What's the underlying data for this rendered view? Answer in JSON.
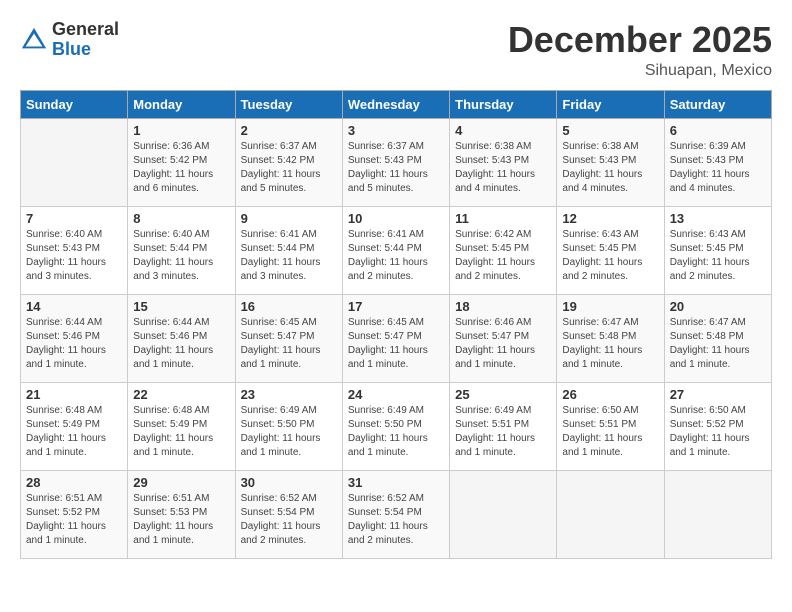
{
  "header": {
    "logo_general": "General",
    "logo_blue": "Blue",
    "month": "December 2025",
    "location": "Sihuapan, Mexico"
  },
  "days_of_week": [
    "Sunday",
    "Monday",
    "Tuesday",
    "Wednesday",
    "Thursday",
    "Friday",
    "Saturday"
  ],
  "weeks": [
    [
      {
        "num": "",
        "sunrise": "",
        "sunset": "",
        "daylight": ""
      },
      {
        "num": "1",
        "sunrise": "Sunrise: 6:36 AM",
        "sunset": "Sunset: 5:42 PM",
        "daylight": "Daylight: 11 hours and 6 minutes."
      },
      {
        "num": "2",
        "sunrise": "Sunrise: 6:37 AM",
        "sunset": "Sunset: 5:42 PM",
        "daylight": "Daylight: 11 hours and 5 minutes."
      },
      {
        "num": "3",
        "sunrise": "Sunrise: 6:37 AM",
        "sunset": "Sunset: 5:43 PM",
        "daylight": "Daylight: 11 hours and 5 minutes."
      },
      {
        "num": "4",
        "sunrise": "Sunrise: 6:38 AM",
        "sunset": "Sunset: 5:43 PM",
        "daylight": "Daylight: 11 hours and 4 minutes."
      },
      {
        "num": "5",
        "sunrise": "Sunrise: 6:38 AM",
        "sunset": "Sunset: 5:43 PM",
        "daylight": "Daylight: 11 hours and 4 minutes."
      },
      {
        "num": "6",
        "sunrise": "Sunrise: 6:39 AM",
        "sunset": "Sunset: 5:43 PM",
        "daylight": "Daylight: 11 hours and 4 minutes."
      }
    ],
    [
      {
        "num": "7",
        "sunrise": "Sunrise: 6:40 AM",
        "sunset": "Sunset: 5:43 PM",
        "daylight": "Daylight: 11 hours and 3 minutes."
      },
      {
        "num": "8",
        "sunrise": "Sunrise: 6:40 AM",
        "sunset": "Sunset: 5:44 PM",
        "daylight": "Daylight: 11 hours and 3 minutes."
      },
      {
        "num": "9",
        "sunrise": "Sunrise: 6:41 AM",
        "sunset": "Sunset: 5:44 PM",
        "daylight": "Daylight: 11 hours and 3 minutes."
      },
      {
        "num": "10",
        "sunrise": "Sunrise: 6:41 AM",
        "sunset": "Sunset: 5:44 PM",
        "daylight": "Daylight: 11 hours and 2 minutes."
      },
      {
        "num": "11",
        "sunrise": "Sunrise: 6:42 AM",
        "sunset": "Sunset: 5:45 PM",
        "daylight": "Daylight: 11 hours and 2 minutes."
      },
      {
        "num": "12",
        "sunrise": "Sunrise: 6:43 AM",
        "sunset": "Sunset: 5:45 PM",
        "daylight": "Daylight: 11 hours and 2 minutes."
      },
      {
        "num": "13",
        "sunrise": "Sunrise: 6:43 AM",
        "sunset": "Sunset: 5:45 PM",
        "daylight": "Daylight: 11 hours and 2 minutes."
      }
    ],
    [
      {
        "num": "14",
        "sunrise": "Sunrise: 6:44 AM",
        "sunset": "Sunset: 5:46 PM",
        "daylight": "Daylight: 11 hours and 1 minute."
      },
      {
        "num": "15",
        "sunrise": "Sunrise: 6:44 AM",
        "sunset": "Sunset: 5:46 PM",
        "daylight": "Daylight: 11 hours and 1 minute."
      },
      {
        "num": "16",
        "sunrise": "Sunrise: 6:45 AM",
        "sunset": "Sunset: 5:47 PM",
        "daylight": "Daylight: 11 hours and 1 minute."
      },
      {
        "num": "17",
        "sunrise": "Sunrise: 6:45 AM",
        "sunset": "Sunset: 5:47 PM",
        "daylight": "Daylight: 11 hours and 1 minute."
      },
      {
        "num": "18",
        "sunrise": "Sunrise: 6:46 AM",
        "sunset": "Sunset: 5:47 PM",
        "daylight": "Daylight: 11 hours and 1 minute."
      },
      {
        "num": "19",
        "sunrise": "Sunrise: 6:47 AM",
        "sunset": "Sunset: 5:48 PM",
        "daylight": "Daylight: 11 hours and 1 minute."
      },
      {
        "num": "20",
        "sunrise": "Sunrise: 6:47 AM",
        "sunset": "Sunset: 5:48 PM",
        "daylight": "Daylight: 11 hours and 1 minute."
      }
    ],
    [
      {
        "num": "21",
        "sunrise": "Sunrise: 6:48 AM",
        "sunset": "Sunset: 5:49 PM",
        "daylight": "Daylight: 11 hours and 1 minute."
      },
      {
        "num": "22",
        "sunrise": "Sunrise: 6:48 AM",
        "sunset": "Sunset: 5:49 PM",
        "daylight": "Daylight: 11 hours and 1 minute."
      },
      {
        "num": "23",
        "sunrise": "Sunrise: 6:49 AM",
        "sunset": "Sunset: 5:50 PM",
        "daylight": "Daylight: 11 hours and 1 minute."
      },
      {
        "num": "24",
        "sunrise": "Sunrise: 6:49 AM",
        "sunset": "Sunset: 5:50 PM",
        "daylight": "Daylight: 11 hours and 1 minute."
      },
      {
        "num": "25",
        "sunrise": "Sunrise: 6:49 AM",
        "sunset": "Sunset: 5:51 PM",
        "daylight": "Daylight: 11 hours and 1 minute."
      },
      {
        "num": "26",
        "sunrise": "Sunrise: 6:50 AM",
        "sunset": "Sunset: 5:51 PM",
        "daylight": "Daylight: 11 hours and 1 minute."
      },
      {
        "num": "27",
        "sunrise": "Sunrise: 6:50 AM",
        "sunset": "Sunset: 5:52 PM",
        "daylight": "Daylight: 11 hours and 1 minute."
      }
    ],
    [
      {
        "num": "28",
        "sunrise": "Sunrise: 6:51 AM",
        "sunset": "Sunset: 5:52 PM",
        "daylight": "Daylight: 11 hours and 1 minute."
      },
      {
        "num": "29",
        "sunrise": "Sunrise: 6:51 AM",
        "sunset": "Sunset: 5:53 PM",
        "daylight": "Daylight: 11 hours and 1 minute."
      },
      {
        "num": "30",
        "sunrise": "Sunrise: 6:52 AM",
        "sunset": "Sunset: 5:54 PM",
        "daylight": "Daylight: 11 hours and 2 minutes."
      },
      {
        "num": "31",
        "sunrise": "Sunrise: 6:52 AM",
        "sunset": "Sunset: 5:54 PM",
        "daylight": "Daylight: 11 hours and 2 minutes."
      },
      {
        "num": "",
        "sunrise": "",
        "sunset": "",
        "daylight": ""
      },
      {
        "num": "",
        "sunrise": "",
        "sunset": "",
        "daylight": ""
      },
      {
        "num": "",
        "sunrise": "",
        "sunset": "",
        "daylight": ""
      }
    ]
  ]
}
